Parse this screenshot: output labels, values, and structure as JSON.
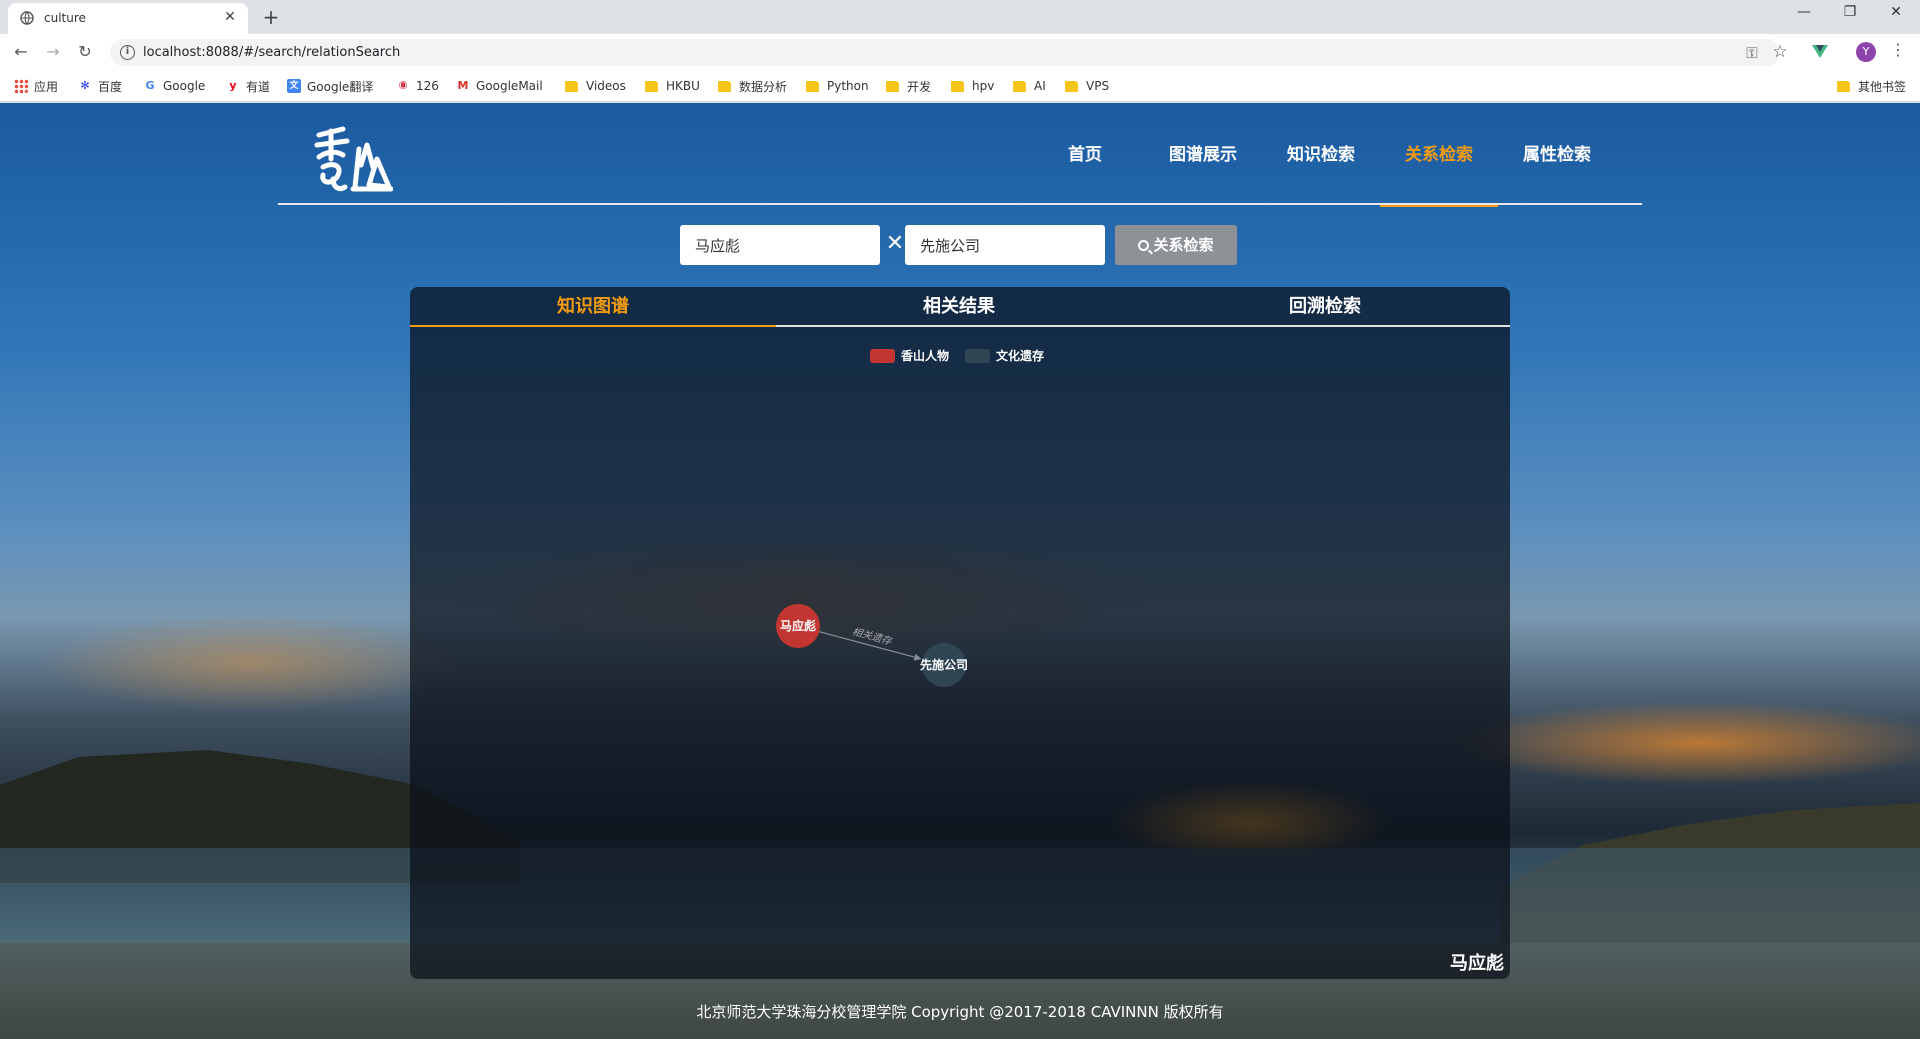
{
  "browser": {
    "tab_title": "culture",
    "url": "localhost:8088/#/search/relationSearch",
    "profile_initial": "Y",
    "bookmarks": [
      {
        "label": "应用",
        "icon": "apps-grid-icon"
      },
      {
        "label": "百度",
        "icon": "baidu-paw-icon"
      },
      {
        "label": "Google",
        "icon": "google-g-icon"
      },
      {
        "label": "有道",
        "icon": "youdao-icon"
      },
      {
        "label": "Google翻译",
        "icon": "google-translate-icon"
      },
      {
        "label": "126",
        "icon": "126-mail-icon"
      },
      {
        "label": "GoogleMail",
        "icon": "gmail-icon"
      },
      {
        "label": "Videos",
        "icon": "folder-icon"
      },
      {
        "label": "HKBU",
        "icon": "folder-icon"
      },
      {
        "label": "数据分析",
        "icon": "folder-icon"
      },
      {
        "label": "Python",
        "icon": "folder-icon"
      },
      {
        "label": "开发",
        "icon": "folder-icon"
      },
      {
        "label": "hpv",
        "icon": "folder-icon"
      },
      {
        "label": "AI",
        "icon": "folder-icon"
      },
      {
        "label": "VPS",
        "icon": "folder-icon"
      }
    ],
    "other_bookmarks": "其他书签"
  },
  "site": {
    "nav": [
      {
        "label": "首页",
        "active": false
      },
      {
        "label": "图谱展示",
        "active": false
      },
      {
        "label": "知识检索",
        "active": false
      },
      {
        "label": "关系检索",
        "active": true
      },
      {
        "label": "属性检索",
        "active": false
      }
    ]
  },
  "search": {
    "entity_a": "马应彪",
    "entity_b": "先施公司",
    "separator": "✕",
    "button_label": "关系检索"
  },
  "panel": {
    "tabs": [
      {
        "label": "知识图谱",
        "active": true
      },
      {
        "label": "相关结果",
        "active": false
      },
      {
        "label": "回溯检索",
        "active": false
      }
    ],
    "legend": [
      {
        "label": "香山人物",
        "color": "#c23531"
      },
      {
        "label": "文化遗存",
        "color": "#2f4554"
      }
    ],
    "corner_label": "马应彪"
  },
  "graph": {
    "nodes": [
      {
        "id": "n1",
        "label": "马应彪",
        "category": "香山人物",
        "color": "#c23531"
      },
      {
        "id": "n2",
        "label": "先施公司",
        "category": "文化遗存",
        "color": "#2f4554"
      }
    ],
    "edges": [
      {
        "source": "n1",
        "target": "n2",
        "label": "相关遗存"
      }
    ]
  },
  "footer": {
    "text": "北京师范大学珠海分校管理学院 Copyright @2017-2018 CAVINNN 版权所有"
  },
  "colors": {
    "accent": "#f39c12",
    "person_node": "#c23531",
    "heritage_node": "#2f4554",
    "button_gray": "#8e9297"
  }
}
